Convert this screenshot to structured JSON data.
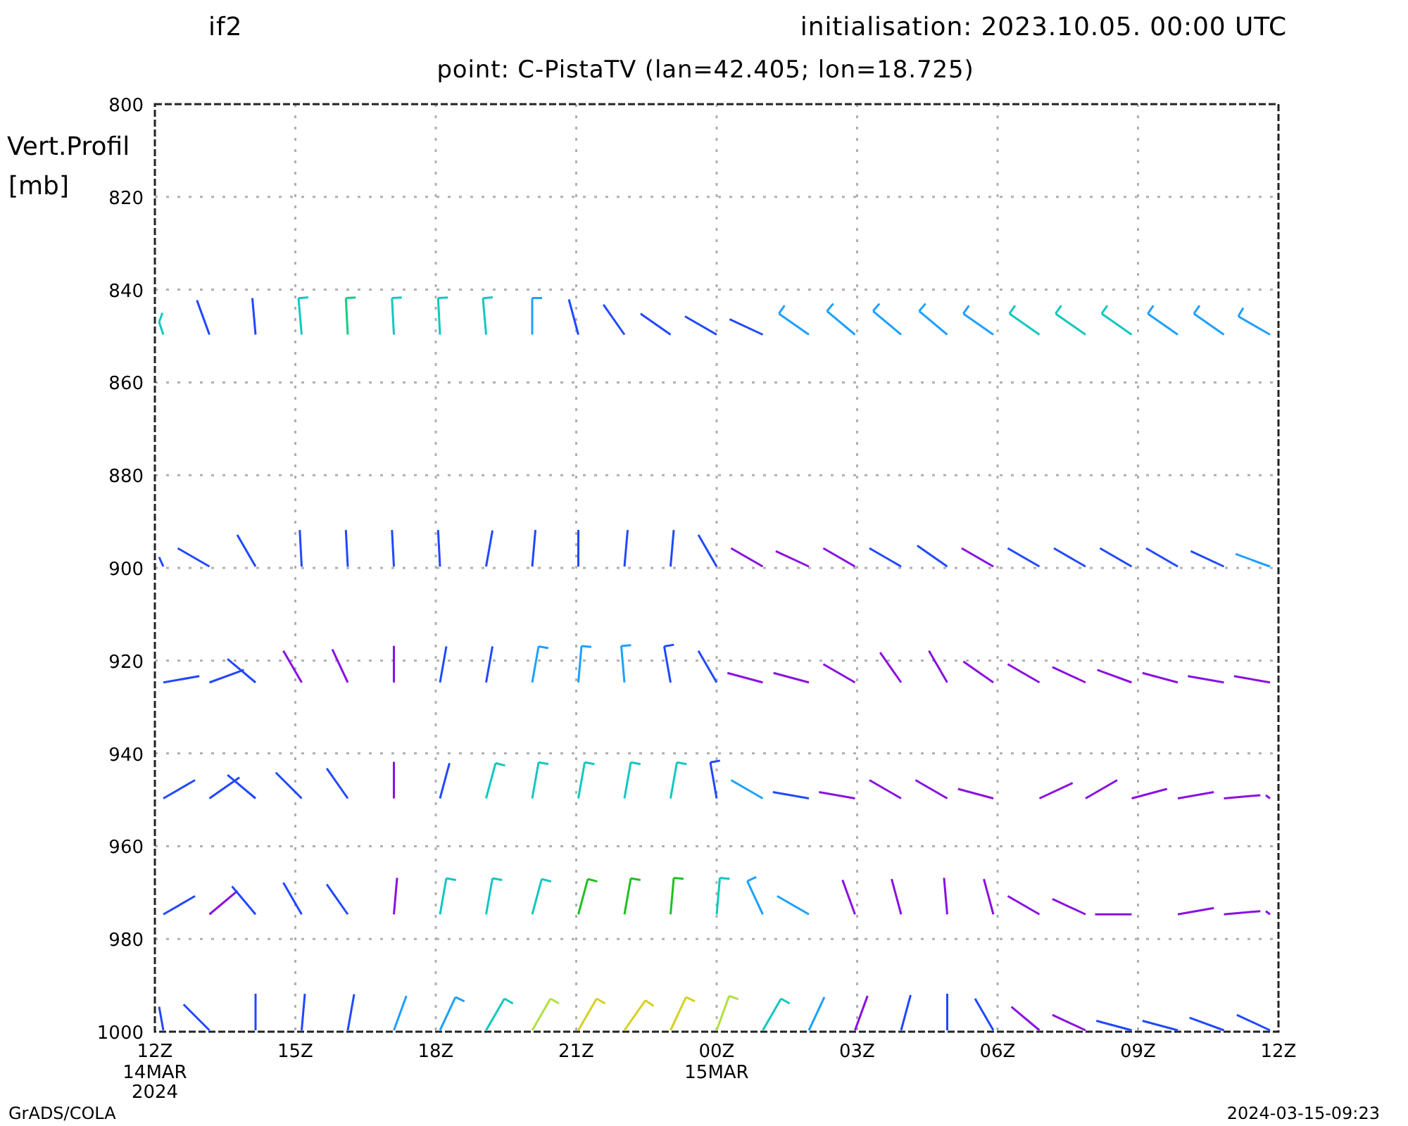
{
  "header": {
    "model": "if2",
    "initialisation": "initialisation: 2023.10.05. 00:00 UTC"
  },
  "plot": {
    "title": "point: C-PistaTV (lan=42.405; lon=18.725)",
    "y_axis": {
      "label": "Vert.Profil",
      "unit": "[mb]",
      "ticks": [
        "800",
        "820",
        "840",
        "860",
        "880",
        "900",
        "920",
        "940",
        "960",
        "980",
        "1000"
      ]
    },
    "x_axis": {
      "ticks": [
        {
          "label": "12Z",
          "date": "14MAR",
          "year": "2024"
        },
        {
          "label": "15Z"
        },
        {
          "label": "18Z"
        },
        {
          "label": "21Z"
        },
        {
          "label": "00Z",
          "date": "15MAR"
        },
        {
          "label": "03Z"
        },
        {
          "label": "06Z"
        },
        {
          "label": "09Z"
        },
        {
          "label": "12Z"
        }
      ]
    }
  },
  "footer": {
    "left": "GrADS/COLA",
    "right": "2024-03-15-09:23"
  }
}
